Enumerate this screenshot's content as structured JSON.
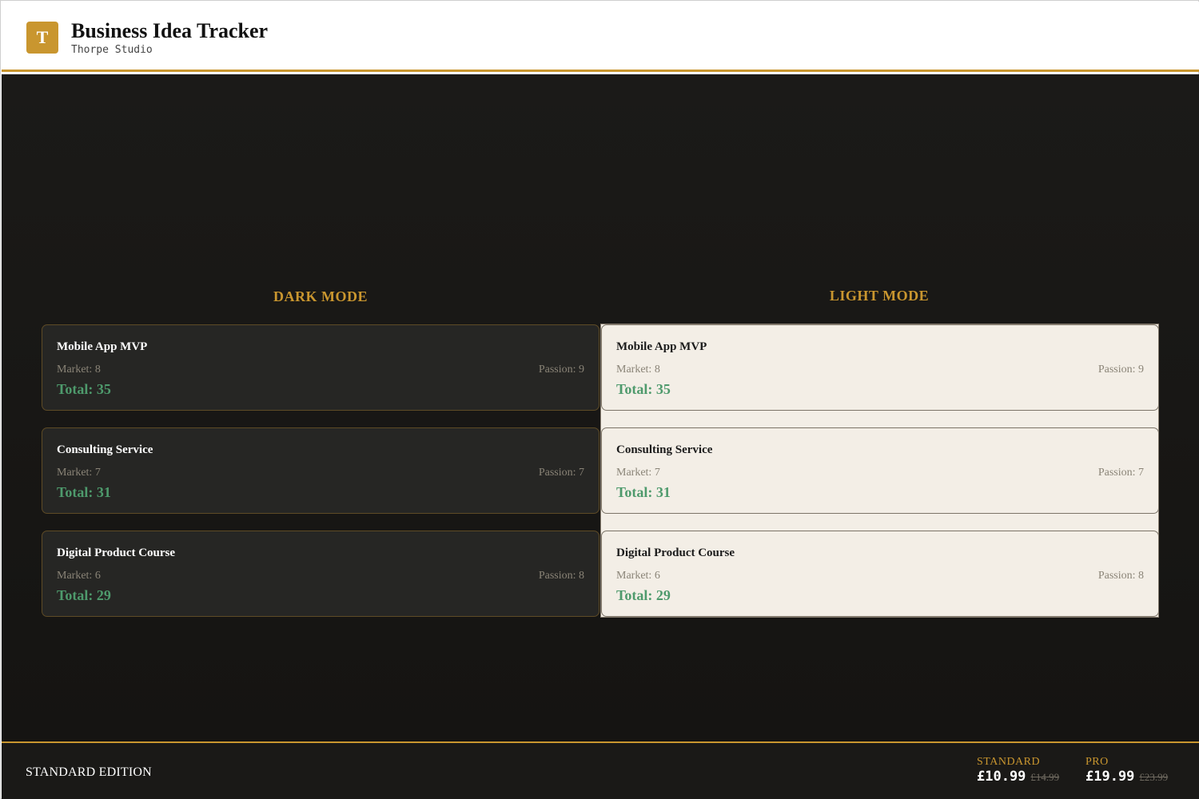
{
  "header": {
    "logo_letter": "T",
    "title": "Business Idea Tracker",
    "subtitle": "Thorpe Studio"
  },
  "columns": {
    "dark": {
      "title": "DARK MODE"
    },
    "light": {
      "title": "LIGHT MODE"
    }
  },
  "ideas": [
    {
      "name": "Mobile App MVP",
      "market": "Market: 8",
      "passion": "Passion: 9",
      "total": "Total: 35"
    },
    {
      "name": "Consulting Service",
      "market": "Market: 7",
      "passion": "Passion: 7",
      "total": "Total: 31"
    },
    {
      "name": "Digital Product Course",
      "market": "Market: 6",
      "passion": "Passion: 8",
      "total": "Total: 29"
    }
  ],
  "footer": {
    "edition": "STANDARD EDITION",
    "plans": [
      {
        "tier": "STANDARD",
        "price": "£10.99",
        "old_price": "£14.99"
      },
      {
        "tier": "PRO",
        "price": "£19.99",
        "old_price": "£23.99"
      }
    ]
  },
  "colors": {
    "accent": "#c9962f",
    "total_green": "#4e9a6c",
    "dark_bg": "#151412",
    "light_card_bg": "#f3eee6"
  }
}
